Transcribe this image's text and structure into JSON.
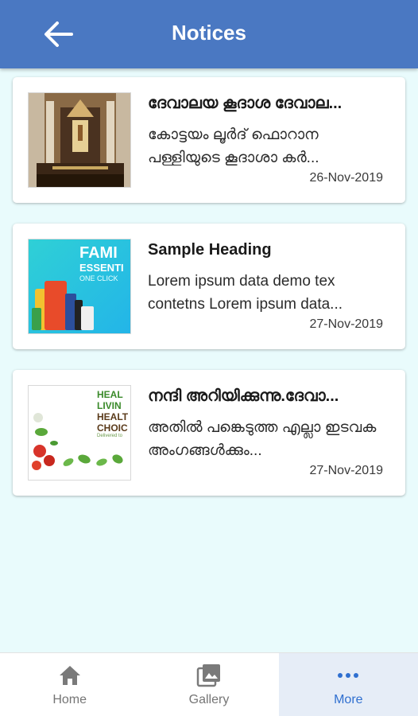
{
  "appbar": {
    "title": "Notices",
    "back_icon": "arrow-left-icon"
  },
  "notices": [
    {
      "title": "ദേവാലയ കൂദാശ ദേവാല...",
      "body": "കോട്ടയം ലൂർദ് ഫൊറാന പള്ളിയുടെ കൂദാശാ കർ...",
      "date": "26-Nov-2019",
      "image": "church-altar-image"
    },
    {
      "title": "Sample Heading",
      "body": "Lorem ipsum data demo tex contetns Lorem ipsum data...",
      "date": "27-Nov-2019",
      "image": "family-essentials-banner-image",
      "image_text": [
        "FAMI",
        "ESSENTI",
        "ONE CLICK"
      ]
    },
    {
      "title": "നന്ദി അറിയിക്കുന്നു.ദേവാ...",
      "body": "അതിൽ പങ്കെടുത്ത എല്ലാ ഇടവക അംഗങ്ങൾക്കും...",
      "date": "27-Nov-2019",
      "image": "healthy-living-banner-image",
      "image_text": [
        "HEAL",
        "LIVIN",
        "HEALT",
        "CHOIC",
        "Delivered to"
      ]
    }
  ],
  "bottom_nav": {
    "items": [
      {
        "label": "Home",
        "icon": "home-icon",
        "active": false
      },
      {
        "label": "Gallery",
        "icon": "gallery-icon",
        "active": false
      },
      {
        "label": "More",
        "icon": "more-dots-icon",
        "active": true
      }
    ]
  },
  "colors": {
    "appbar": "#4a78c2",
    "background": "#e9fbfc",
    "active_nav": "#2f6fd0"
  }
}
